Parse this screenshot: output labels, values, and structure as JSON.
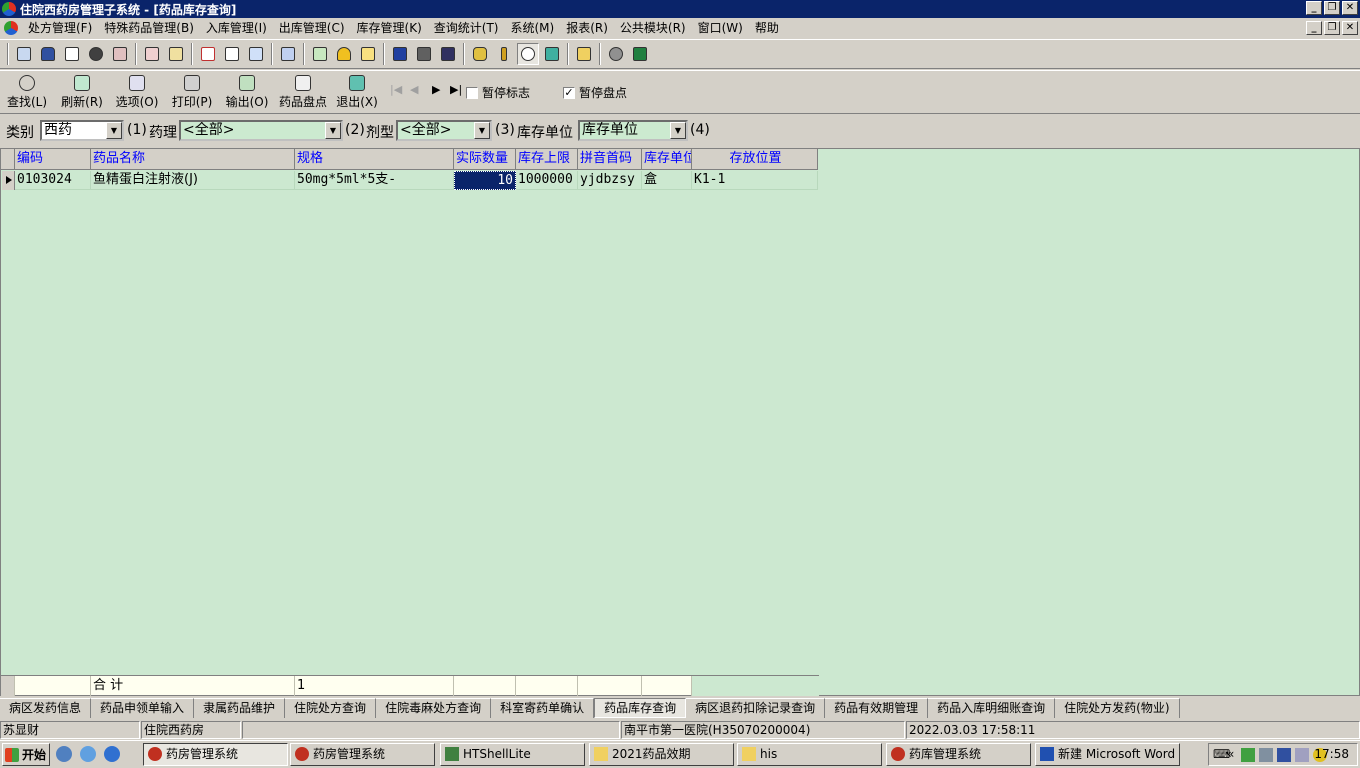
{
  "window": {
    "title": "住院西药房管理子系统 - [药品库存查询]"
  },
  "menu": [
    "处方管理(F)",
    "特殊药品管理(B)",
    "入库管理(I)",
    "出库管理(C)",
    "库存管理(K)",
    "查询统计(T)",
    "系统(M)",
    "报表(R)",
    "公共模块(R)",
    "窗口(W)",
    "帮助"
  ],
  "toolbar2": {
    "buttons": [
      "查找(L)",
      "刷新(R)",
      "选项(O)",
      "打印(P)",
      "输出(O)",
      "药品盘点",
      "退出(X)"
    ],
    "pause_flag_label": "暂停标志",
    "pause_inventory_label": "暂停盘点",
    "pause_flag_checked": false,
    "pause_inventory_checked": true
  },
  "filters": {
    "category_label": "类别",
    "category_value": "西药",
    "tag1": "(1)",
    "pharmacology_label": "药理",
    "pharmacology_value": "<全部>",
    "tag2": "(2)",
    "dosage_label": "剂型",
    "dosage_value": "<全部>",
    "tag3": "(3)",
    "unit_label": "库存单位",
    "unit_value": "库存单位",
    "tag4": "(4)"
  },
  "table": {
    "headers": [
      "编码",
      "药品名称",
      "规格",
      "实际数量",
      "库存上限",
      "拼音首码",
      "库存单位",
      "存放位置"
    ],
    "rows": [
      [
        "0103024",
        "鱼精蛋白注射液(J)",
        "50mg*5ml*5支-",
        "10",
        "1000000",
        "yjdbzsy",
        "盒",
        "K1-1"
      ]
    ],
    "footer": {
      "label": "合 计",
      "count": "1"
    }
  },
  "tabs": [
    "病区发药信息",
    "药品申领单输入",
    "隶属药品维护",
    "住院处方查询",
    "住院毒麻处方查询",
    "科室寄药单确认",
    "药品库存查询",
    "病区退药扣除记录查询",
    "药品有效期管理",
    "药品入库明细账查询",
    "住院处方发药(物业)"
  ],
  "active_tab": "药品库存查询",
  "status": {
    "user": "苏显财",
    "dept": "住院西药房",
    "hospital": "南平市第一医院(H35070200004)",
    "datetime": "2022.03.03 17:58:11"
  },
  "taskbar": {
    "start": "开始",
    "tasks": [
      "药房管理系统",
      "药房管理系统",
      "HTShellLite",
      "2021药品效期",
      "his",
      "药库管理系统",
      "新建 Microsoft Word ..."
    ],
    "clock": "17:58"
  }
}
